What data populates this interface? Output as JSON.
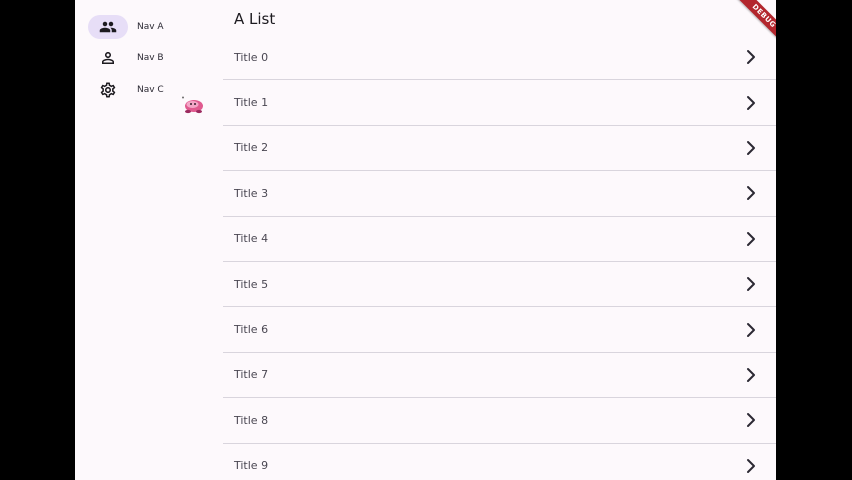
{
  "nav": {
    "items": [
      {
        "label": "Nav A",
        "icon": "people-icon",
        "selected": true
      },
      {
        "label": "Nav B",
        "icon": "person-icon",
        "selected": false
      },
      {
        "label": "Nav C",
        "icon": "gear-icon",
        "selected": false
      }
    ]
  },
  "main": {
    "title": "A List",
    "items": [
      {
        "title": "Title 0"
      },
      {
        "title": "Title 1"
      },
      {
        "title": "Title 2"
      },
      {
        "title": "Title 3"
      },
      {
        "title": "Title 4"
      },
      {
        "title": "Title 5"
      },
      {
        "title": "Title 6"
      },
      {
        "title": "Title 7"
      },
      {
        "title": "Title 8"
      },
      {
        "title": "Title 9"
      }
    ]
  },
  "debug_banner": {
    "label": "DEBUG"
  },
  "colors": {
    "background": "#fdf9fc",
    "nav_selected_pill": "#e7def7",
    "divider": "#d9d5dd",
    "debug_ribbon": "#b3262d",
    "mascot": "#e05a8f"
  }
}
